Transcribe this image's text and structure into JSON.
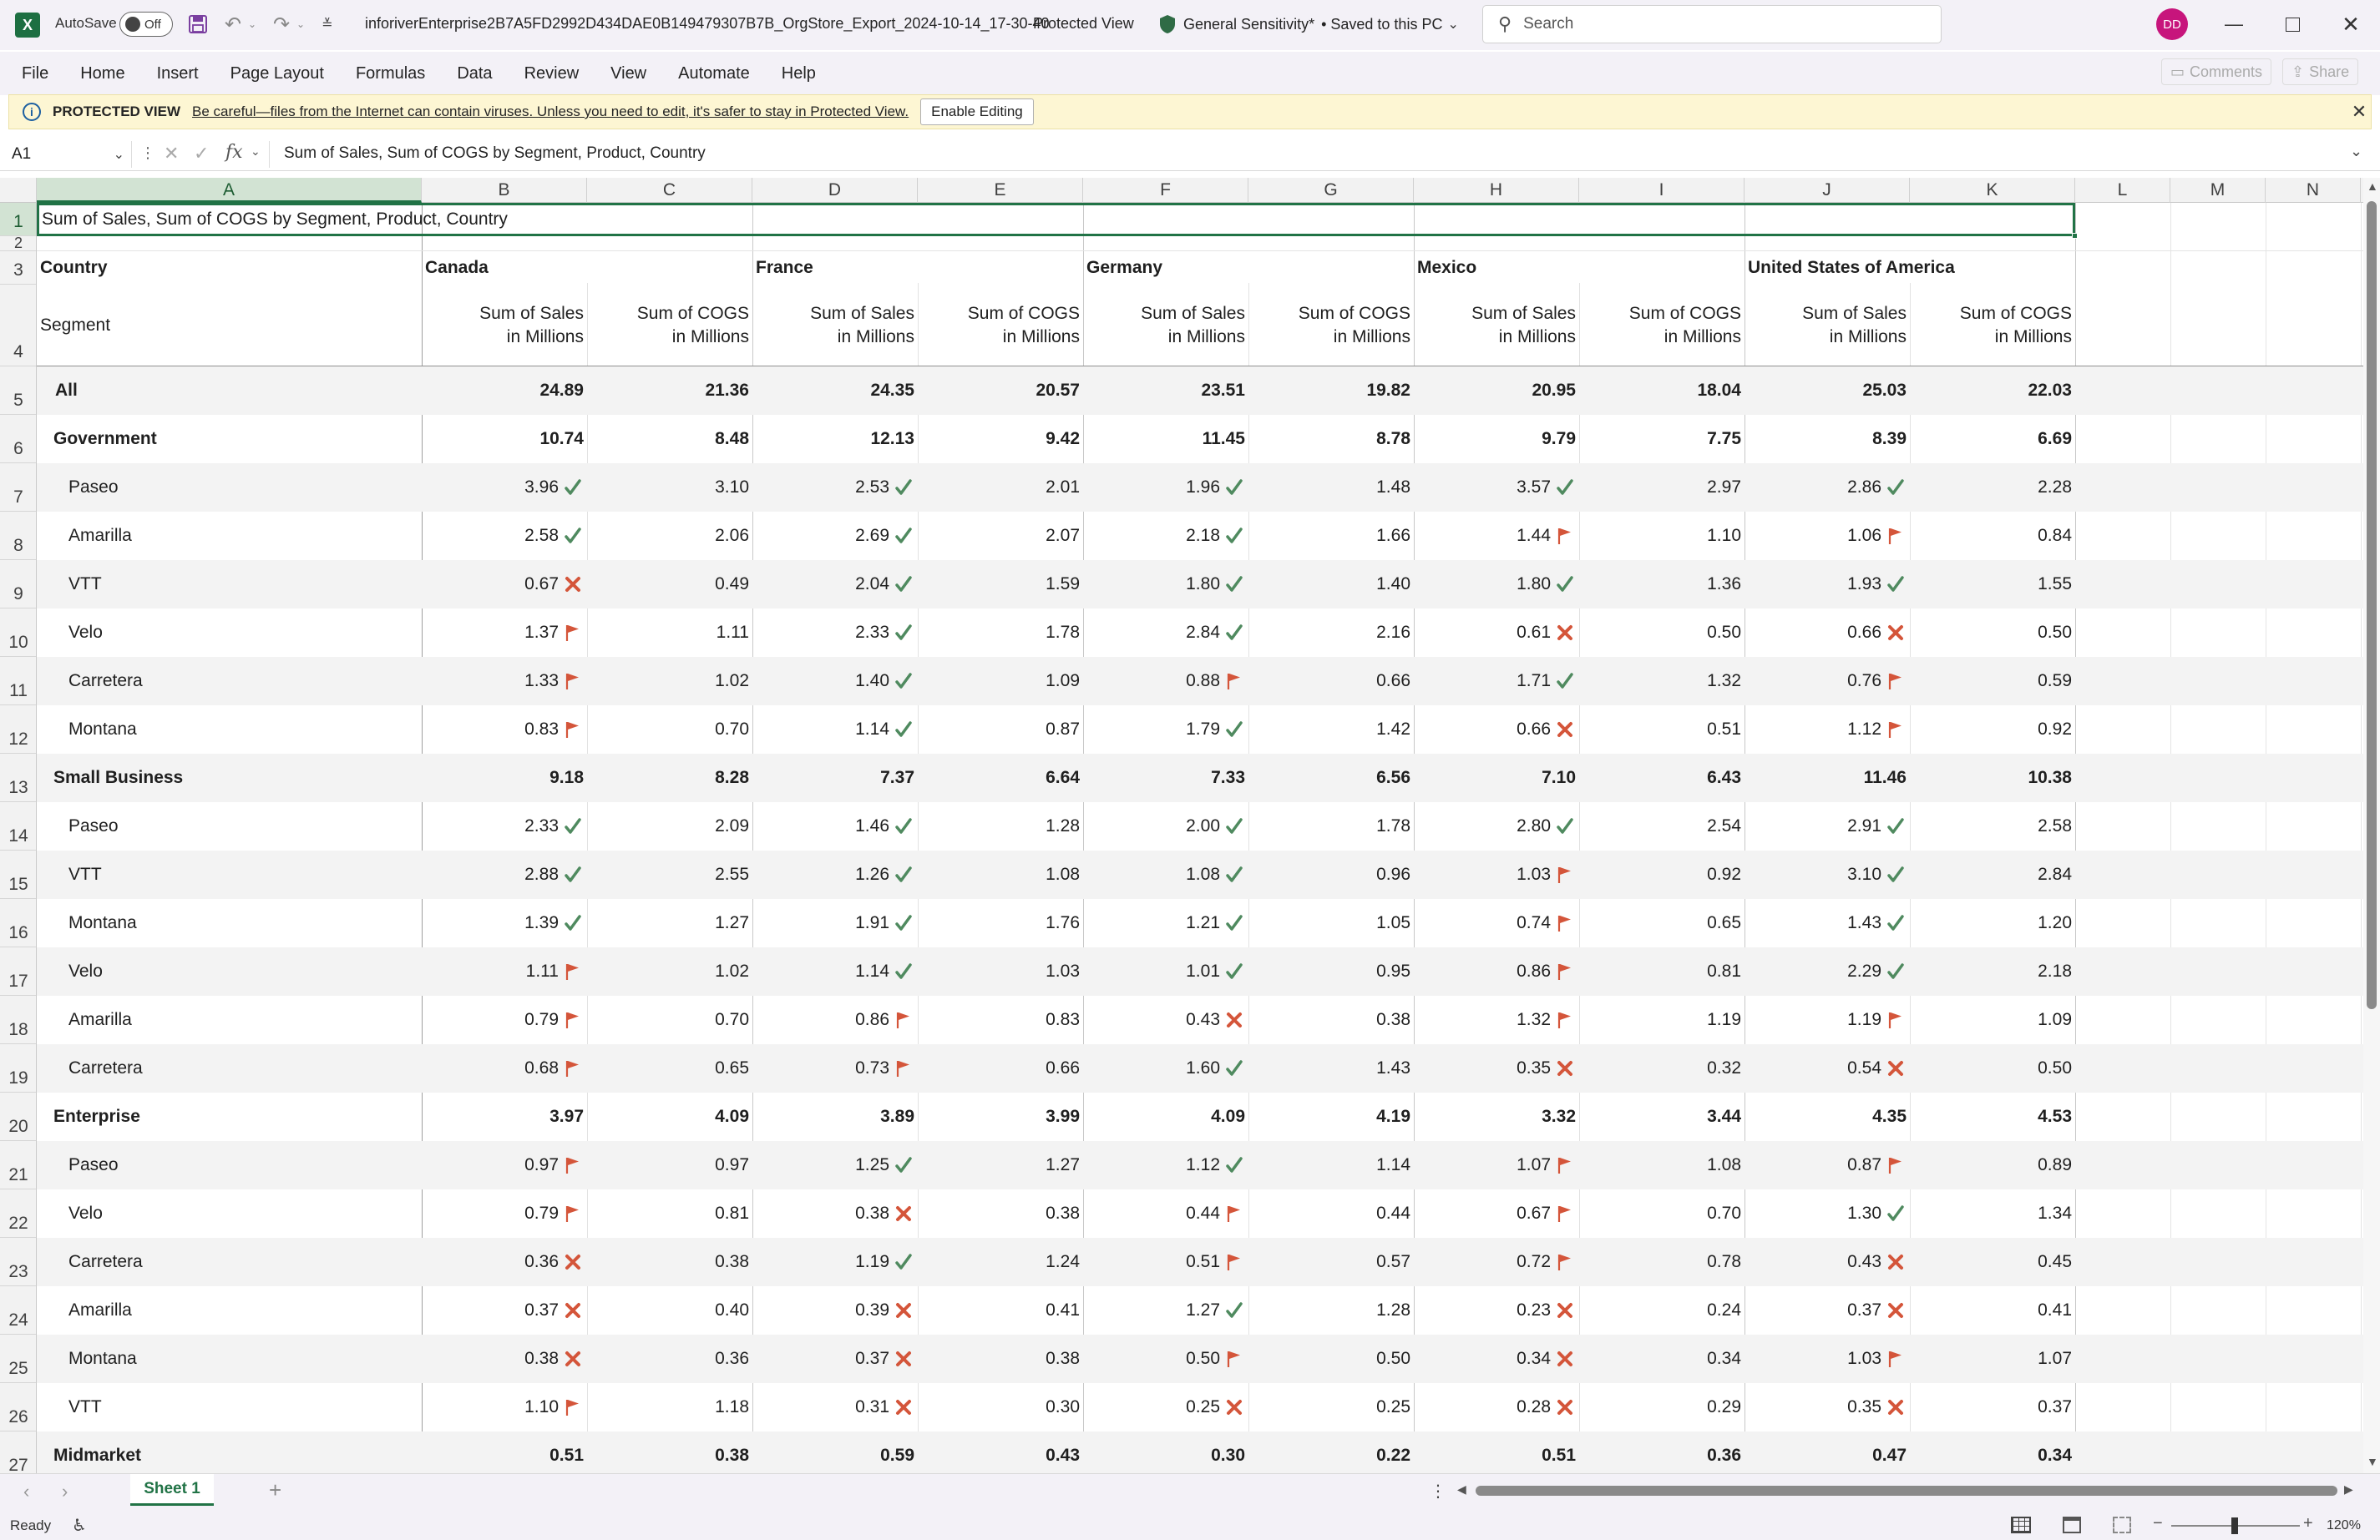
{
  "app": {
    "autosave_label": "AutoSave",
    "autosave_state": "Off",
    "filename": "inforiverEnterprise2B7A5FD2992D434DAE0B149479307B7B_OrgStore_Export_2024-10-14_17-30-40",
    "view_mode": "Protected View",
    "sensitivity": "General Sensitivity*",
    "saved_state": "• Saved to this PC",
    "search_placeholder": "Search",
    "user_initials": "DD",
    "accent_color": "#217346",
    "avatar_color": "#c7157c"
  },
  "ribbon": {
    "menus": [
      "File",
      "Home",
      "Insert",
      "Page Layout",
      "Formulas",
      "Data",
      "Review",
      "View",
      "Automate",
      "Help"
    ],
    "comments_label": "Comments",
    "share_label": "Share"
  },
  "protected_bar": {
    "title": "PROTECTED VIEW",
    "message": "Be careful—files from the Internet can contain viruses. Unless you need to edit, it's safer to stay in Protected View.",
    "button": "Enable Editing"
  },
  "formula_bar": {
    "name_box": "A1",
    "fx": "fx",
    "content": "Sum of  Sales, Sum of COGS by Segment, Product, Country"
  },
  "columns": [
    "A",
    "B",
    "C",
    "D",
    "E",
    "F",
    "G",
    "H",
    "I",
    "J",
    "K",
    "L",
    "M",
    "N"
  ],
  "rows": [
    "1",
    "2",
    "3",
    "4",
    "5",
    "6",
    "7",
    "8",
    "9",
    "10",
    "11",
    "12",
    "13",
    "14",
    "15",
    "16",
    "17",
    "18",
    "19",
    "20",
    "21",
    "22",
    "23",
    "24",
    "25",
    "26",
    "27"
  ],
  "sheet": {
    "title": "Sum of  Sales, Sum of COGS by Segment, Product, Country",
    "country_label": "Country",
    "segment_label": "Segment",
    "countries": [
      "Canada",
      "France",
      "Germany",
      "Mexico",
      "United States of America"
    ],
    "measure_sales": "Sum of  Sales",
    "measure_cogs": "Sum of COGS",
    "measure_unit": "in Millions",
    "indicator_colors": {
      "check": "#4f8a5f",
      "flag": "#d4553a",
      "cross": "#d4553a"
    },
    "data_rows": [
      {
        "label": "All",
        "level": 0,
        "values": [
          "24.89",
          "21.36",
          "24.35",
          "20.57",
          "23.51",
          "19.82",
          "20.95",
          "18.04",
          "25.03",
          "22.03"
        ],
        "icons": [
          "",
          "",
          "",
          "",
          ""
        ]
      },
      {
        "label": "Government",
        "level": 1,
        "values": [
          "10.74",
          "8.48",
          "12.13",
          "9.42",
          "11.45",
          "8.78",
          "9.79",
          "7.75",
          "8.39",
          "6.69"
        ],
        "icons": [
          "",
          "",
          "",
          "",
          ""
        ]
      },
      {
        "label": "Paseo",
        "level": 2,
        "values": [
          "3.96",
          "3.10",
          "2.53",
          "2.01",
          "1.96",
          "1.48",
          "3.57",
          "2.97",
          "2.86",
          "2.28"
        ],
        "icons": [
          "check",
          "check",
          "check",
          "check",
          "check"
        ]
      },
      {
        "label": "Amarilla",
        "level": 2,
        "values": [
          "2.58",
          "2.06",
          "2.69",
          "2.07",
          "2.18",
          "1.66",
          "1.44",
          "1.10",
          "1.06",
          "0.84"
        ],
        "icons": [
          "check",
          "check",
          "check",
          "flag",
          "flag"
        ]
      },
      {
        "label": "VTT",
        "level": 2,
        "values": [
          "0.67",
          "0.49",
          "2.04",
          "1.59",
          "1.80",
          "1.40",
          "1.80",
          "1.36",
          "1.93",
          "1.55"
        ],
        "icons": [
          "cross",
          "check",
          "check",
          "check",
          "check"
        ]
      },
      {
        "label": "Velo",
        "level": 2,
        "values": [
          "1.37",
          "1.11",
          "2.33",
          "1.78",
          "2.84",
          "2.16",
          "0.61",
          "0.50",
          "0.66",
          "0.50"
        ],
        "icons": [
          "flag",
          "check",
          "check",
          "cross",
          "cross"
        ]
      },
      {
        "label": "Carretera",
        "level": 2,
        "values": [
          "1.33",
          "1.02",
          "1.40",
          "1.09",
          "0.88",
          "0.66",
          "1.71",
          "1.32",
          "0.76",
          "0.59"
        ],
        "icons": [
          "flag",
          "check",
          "flag",
          "check",
          "flag"
        ]
      },
      {
        "label": "Montana",
        "level": 2,
        "values": [
          "0.83",
          "0.70",
          "1.14",
          "0.87",
          "1.79",
          "1.42",
          "0.66",
          "0.51",
          "1.12",
          "0.92"
        ],
        "icons": [
          "flag",
          "check",
          "check",
          "cross",
          "flag"
        ]
      },
      {
        "label": "Small Business",
        "level": 1,
        "values": [
          "9.18",
          "8.28",
          "7.37",
          "6.64",
          "7.33",
          "6.56",
          "7.10",
          "6.43",
          "11.46",
          "10.38"
        ],
        "icons": [
          "",
          "",
          "",
          "",
          ""
        ]
      },
      {
        "label": "Paseo",
        "level": 2,
        "values": [
          "2.33",
          "2.09",
          "1.46",
          "1.28",
          "2.00",
          "1.78",
          "2.80",
          "2.54",
          "2.91",
          "2.58"
        ],
        "icons": [
          "check",
          "check",
          "check",
          "check",
          "check"
        ]
      },
      {
        "label": "VTT",
        "level": 2,
        "values": [
          "2.88",
          "2.55",
          "1.26",
          "1.08",
          "1.08",
          "0.96",
          "1.03",
          "0.92",
          "3.10",
          "2.84"
        ],
        "icons": [
          "check",
          "check",
          "check",
          "flag",
          "check"
        ]
      },
      {
        "label": "Montana",
        "level": 2,
        "values": [
          "1.39",
          "1.27",
          "1.91",
          "1.76",
          "1.21",
          "1.05",
          "0.74",
          "0.65",
          "1.43",
          "1.20"
        ],
        "icons": [
          "check",
          "check",
          "check",
          "flag",
          "check"
        ]
      },
      {
        "label": "Velo",
        "level": 2,
        "values": [
          "1.11",
          "1.02",
          "1.14",
          "1.03",
          "1.01",
          "0.95",
          "0.86",
          "0.81",
          "2.29",
          "2.18"
        ],
        "icons": [
          "flag",
          "check",
          "check",
          "flag",
          "check"
        ]
      },
      {
        "label": "Amarilla",
        "level": 2,
        "values": [
          "0.79",
          "0.70",
          "0.86",
          "0.83",
          "0.43",
          "0.38",
          "1.32",
          "1.19",
          "1.19",
          "1.09"
        ],
        "icons": [
          "flag",
          "flag",
          "cross",
          "flag",
          "flag"
        ]
      },
      {
        "label": "Carretera",
        "level": 2,
        "values": [
          "0.68",
          "0.65",
          "0.73",
          "0.66",
          "1.60",
          "1.43",
          "0.35",
          "0.32",
          "0.54",
          "0.50"
        ],
        "icons": [
          "flag",
          "flag",
          "check",
          "cross",
          "cross"
        ]
      },
      {
        "label": "Enterprise",
        "level": 1,
        "values": [
          "3.97",
          "4.09",
          "3.89",
          "3.99",
          "4.09",
          "4.19",
          "3.32",
          "3.44",
          "4.35",
          "4.53"
        ],
        "icons": [
          "",
          "",
          "",
          "",
          ""
        ]
      },
      {
        "label": "Paseo",
        "level": 2,
        "values": [
          "0.97",
          "0.97",
          "1.25",
          "1.27",
          "1.12",
          "1.14",
          "1.07",
          "1.08",
          "0.87",
          "0.89"
        ],
        "icons": [
          "flag",
          "check",
          "check",
          "flag",
          "flag"
        ]
      },
      {
        "label": "Velo",
        "level": 2,
        "values": [
          "0.79",
          "0.81",
          "0.38",
          "0.38",
          "0.44",
          "0.44",
          "0.67",
          "0.70",
          "1.30",
          "1.34"
        ],
        "icons": [
          "flag",
          "cross",
          "flag",
          "flag",
          "check"
        ]
      },
      {
        "label": "Carretera",
        "level": 2,
        "values": [
          "0.36",
          "0.38",
          "1.19",
          "1.24",
          "0.51",
          "0.57",
          "0.72",
          "0.78",
          "0.43",
          "0.45"
        ],
        "icons": [
          "cross",
          "check",
          "flag",
          "flag",
          "cross"
        ]
      },
      {
        "label": "Amarilla",
        "level": 2,
        "values": [
          "0.37",
          "0.40",
          "0.39",
          "0.41",
          "1.27",
          "1.28",
          "0.23",
          "0.24",
          "0.37",
          "0.41"
        ],
        "icons": [
          "cross",
          "cross",
          "check",
          "cross",
          "cross"
        ]
      },
      {
        "label": "Montana",
        "level": 2,
        "values": [
          "0.38",
          "0.36",
          "0.37",
          "0.38",
          "0.50",
          "0.50",
          "0.34",
          "0.34",
          "1.03",
          "1.07"
        ],
        "icons": [
          "cross",
          "cross",
          "flag",
          "cross",
          "flag"
        ]
      },
      {
        "label": "VTT",
        "level": 2,
        "values": [
          "1.10",
          "1.18",
          "0.31",
          "0.30",
          "0.25",
          "0.25",
          "0.28",
          "0.29",
          "0.35",
          "0.37"
        ],
        "icons": [
          "flag",
          "cross",
          "cross",
          "cross",
          "cross"
        ]
      },
      {
        "label": "Midmarket",
        "level": 1,
        "values": [
          "0.51",
          "0.38",
          "0.59",
          "0.43",
          "0.30",
          "0.22",
          "0.51",
          "0.36",
          "0.47",
          "0.34"
        ],
        "icons": [
          "",
          "",
          "",
          "",
          ""
        ]
      }
    ]
  },
  "tabs": {
    "sheet_name": "Sheet 1",
    "add": "+"
  },
  "status": {
    "ready": "Ready",
    "zoom": "120%",
    "zoom_minus": "−",
    "zoom_plus": "+"
  }
}
